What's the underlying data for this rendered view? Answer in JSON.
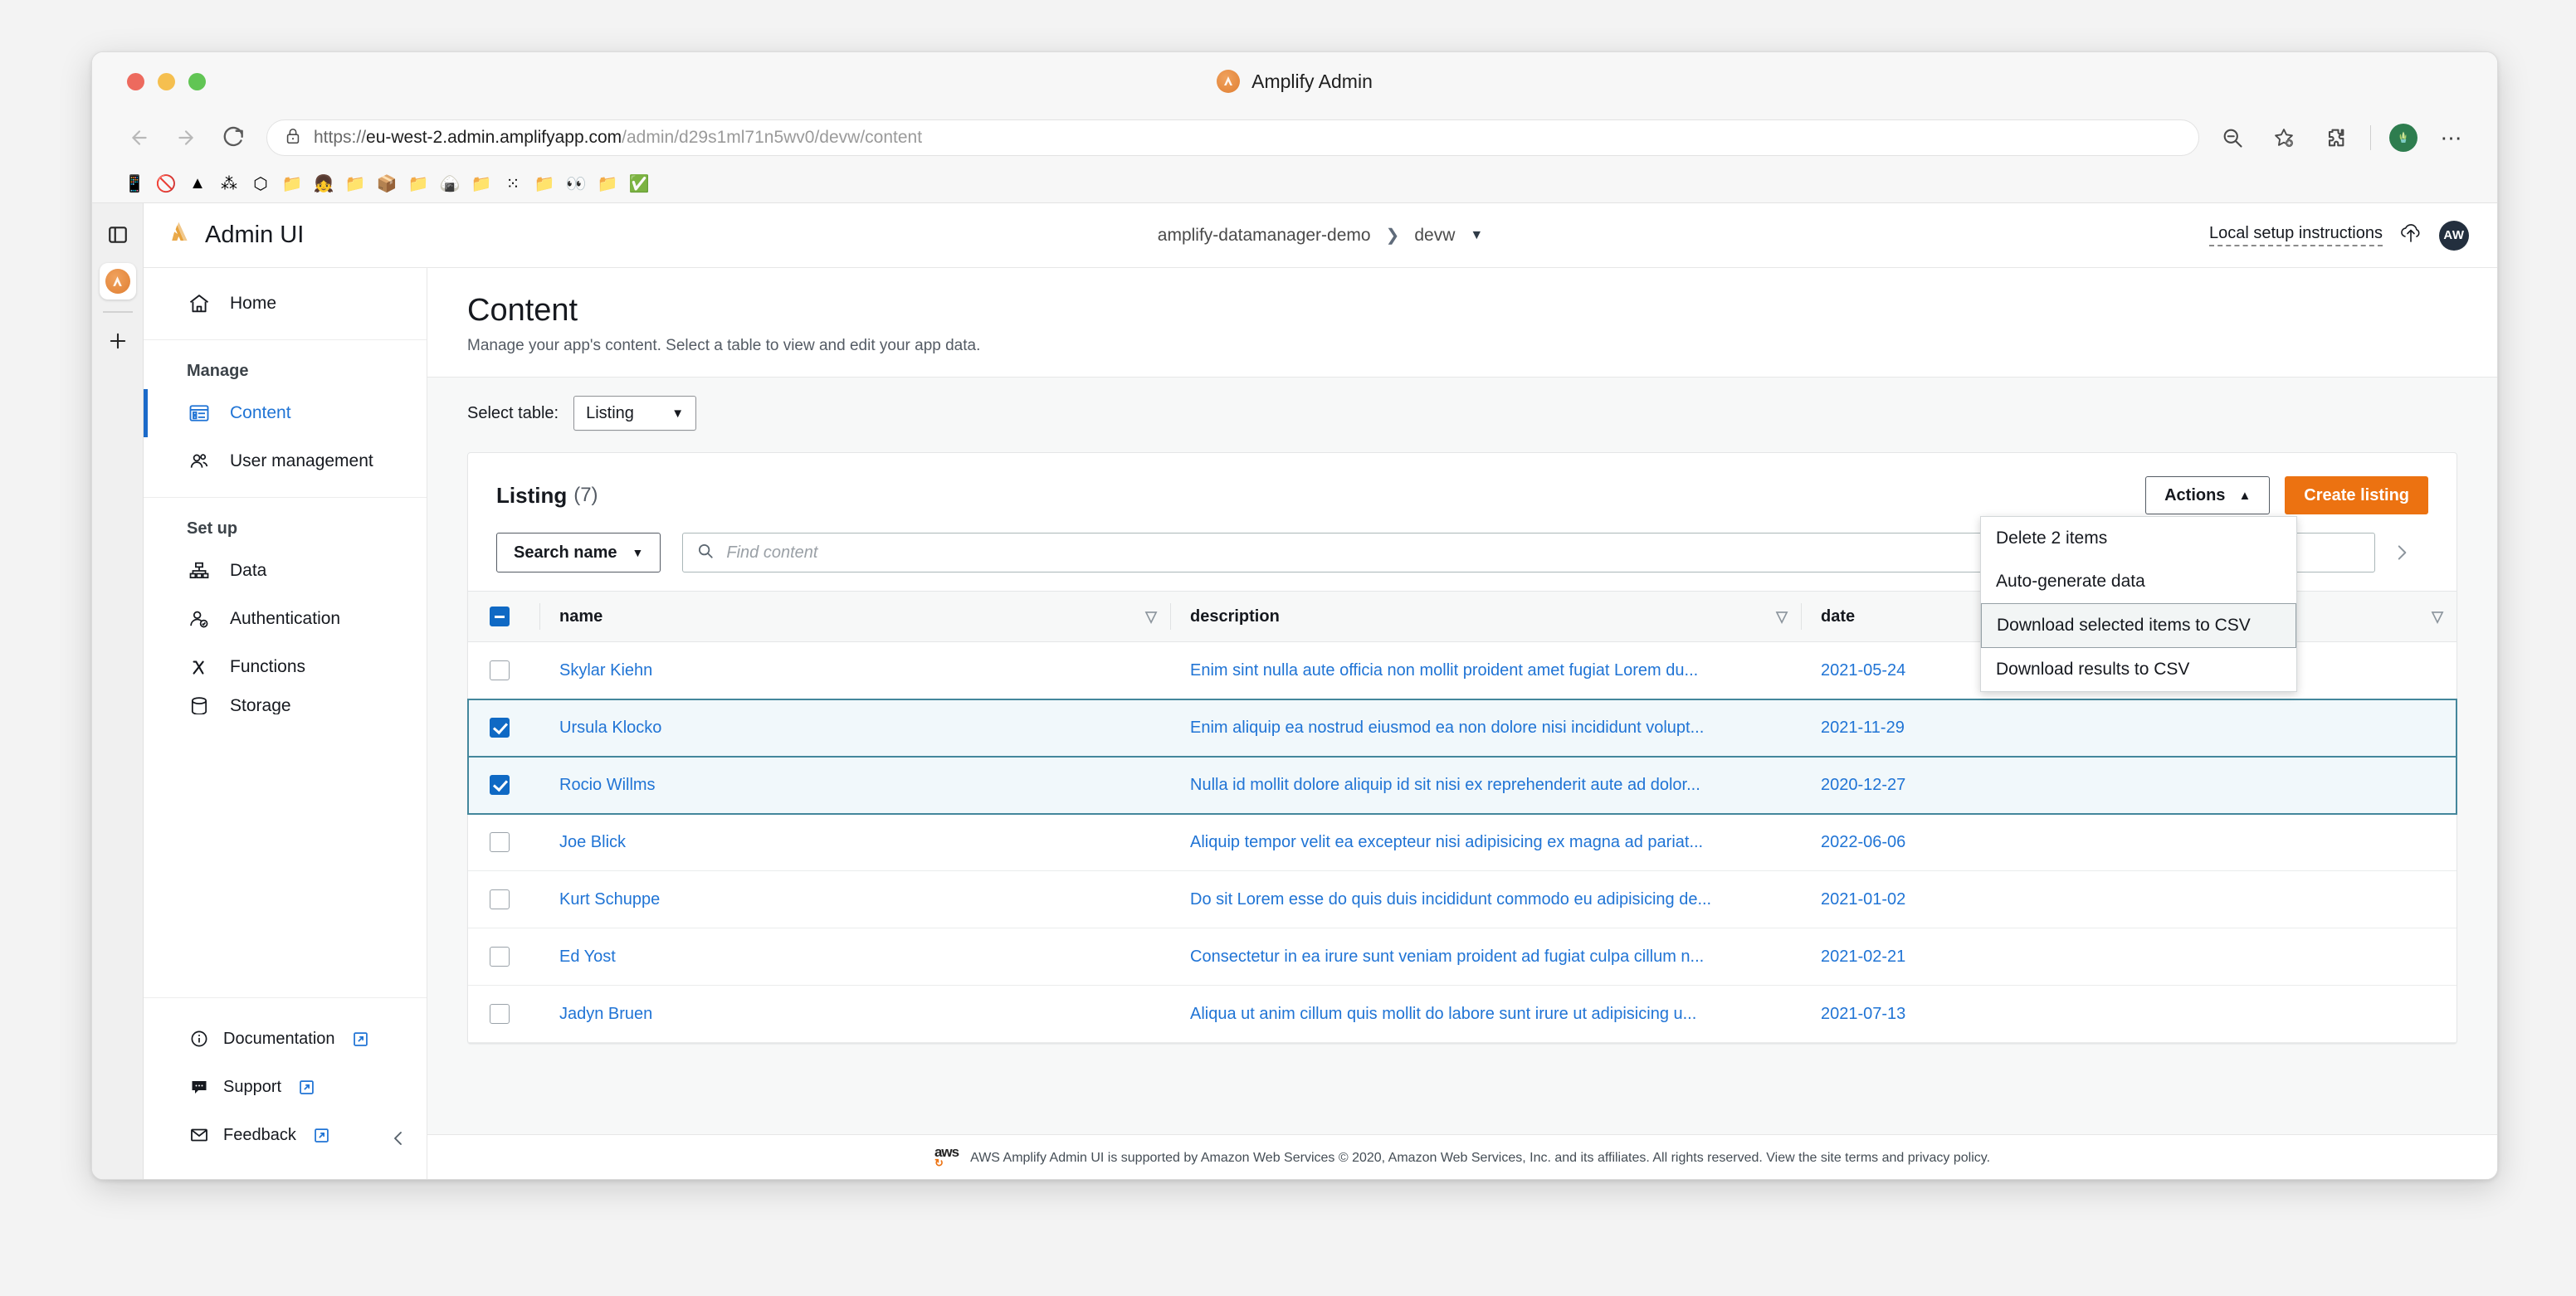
{
  "window": {
    "title": "Amplify Admin",
    "url_scheme": "https://",
    "url_host": "eu-west-2.admin.amplifyapp.com",
    "url_path": "/admin/d29s1ml71n5wv0/devw/content"
  },
  "browser": {
    "back_label": "Back",
    "forward_label": "Forward",
    "reload_label": "Reload",
    "zoom_out_label": "Zoom out",
    "bookmark_label": "Add to favorites",
    "extensions_label": "Extensions",
    "profile_label": "Profile",
    "more_label": "Settings and more",
    "bookmarks": [
      {
        "name": "bookmark-phone",
        "glyph": "📱"
      },
      {
        "name": "bookmark-blocked",
        "glyph": "🚫"
      },
      {
        "name": "bookmark-amplify",
        "glyph": "▲"
      },
      {
        "name": "bookmark-cluster",
        "glyph": "⁂"
      },
      {
        "name": "bookmark-gem",
        "glyph": "⬡"
      },
      {
        "name": "bookmark-folder-1",
        "glyph": "📁"
      },
      {
        "name": "bookmark-person",
        "glyph": "👧"
      },
      {
        "name": "bookmark-folder-2",
        "glyph": "📁"
      },
      {
        "name": "bookmark-package",
        "glyph": "📦"
      },
      {
        "name": "bookmark-folder-3",
        "glyph": "📁"
      },
      {
        "name": "bookmark-rice",
        "glyph": "🍙"
      },
      {
        "name": "bookmark-folder-4",
        "glyph": "📁"
      },
      {
        "name": "bookmark-dots",
        "glyph": "⁙"
      },
      {
        "name": "bookmark-folder-5",
        "glyph": "📁"
      },
      {
        "name": "bookmark-eyes",
        "glyph": "👀"
      },
      {
        "name": "bookmark-folder-6",
        "glyph": "📁"
      },
      {
        "name": "bookmark-check",
        "glyph": "✅"
      }
    ]
  },
  "app": {
    "logo_title": "Admin UI",
    "breadcrumb": {
      "app_name": "amplify-datamanager-demo",
      "separator": "›",
      "environment": "devw"
    },
    "local_setup_label": "Local setup instructions",
    "avatar_initials": "AW"
  },
  "sidebar": {
    "home_label": "Home",
    "manage_label": "Manage",
    "manage_items": [
      {
        "label": "Content",
        "active": true
      },
      {
        "label": "User management",
        "active": false
      }
    ],
    "setup_label": "Set up",
    "setup_items": [
      {
        "label": "Data"
      },
      {
        "label": "Authentication"
      },
      {
        "label": "Functions"
      },
      {
        "label": "Storage"
      }
    ],
    "bottom_items": [
      {
        "label": "Documentation",
        "external": true
      },
      {
        "label": "Support",
        "external": true
      },
      {
        "label": "Feedback",
        "external": true
      }
    ],
    "collapse_label": "Collapse menu"
  },
  "content": {
    "title": "Content",
    "subtitle": "Manage your app's content. Select a table to view and edit your app data.",
    "select_table_label": "Select table:",
    "selected_table": "Listing"
  },
  "panel": {
    "title": "Listing",
    "count": "(7)",
    "actions_label": "Actions",
    "create_label": "Create listing",
    "search_field_label": "Search name",
    "search_placeholder": "Find content",
    "next_page_label": "Next page"
  },
  "actions_menu": {
    "items": [
      {
        "label": "Delete 2 items",
        "highlighted": false
      },
      {
        "label": "Auto-generate data",
        "highlighted": false
      },
      {
        "label": "Download selected items to CSV",
        "highlighted": true
      },
      {
        "label": "Download results to CSV",
        "highlighted": false
      }
    ]
  },
  "table": {
    "columns": [
      "name",
      "description",
      "date"
    ],
    "header_checkbox_state": "indeterminate",
    "rows": [
      {
        "selected": false,
        "name": "Skylar Kiehn",
        "description": "Enim sint nulla aute officia non mollit proident amet fugiat Lorem du...",
        "date": "2021-05-24"
      },
      {
        "selected": true,
        "name": "Ursula Klocko",
        "description": "Enim aliquip ea nostrud eiusmod ea non dolore nisi incididunt volupt...",
        "date": "2021-11-29"
      },
      {
        "selected": true,
        "name": "Rocio Willms",
        "description": "Nulla id mollit dolore aliquip id sit nisi ex reprehenderit aute ad dolor...",
        "date": "2020-12-27"
      },
      {
        "selected": false,
        "name": "Joe Blick",
        "description": "Aliquip tempor velit ea excepteur nisi adipisicing ex magna ad pariat...",
        "date": "2022-06-06"
      },
      {
        "selected": false,
        "name": "Kurt Schuppe",
        "description": "Do sit Lorem esse do quis duis incididunt commodo eu adipisicing de...",
        "date": "2021-01-02"
      },
      {
        "selected": false,
        "name": "Ed Yost",
        "description": "Consectetur in ea irure sunt veniam proident ad fugiat culpa cillum n...",
        "date": "2021-02-21"
      },
      {
        "selected": false,
        "name": "Jadyn Bruen",
        "description": "Aliqua ut anim cillum quis mollit do labore sunt irure ut adipisicing u...",
        "date": "2021-07-13"
      }
    ]
  },
  "footer": {
    "text": "AWS Amplify Admin UI is supported by Amazon Web Services © 2020, Amazon Web Services, Inc. and its affiliates. All rights reserved. View the site terms and privacy policy."
  },
  "colors": {
    "accent_orange": "#ec7211",
    "link_blue": "#2074d5",
    "selected_row": "#f1f8fb",
    "selected_border": "#44879c"
  }
}
